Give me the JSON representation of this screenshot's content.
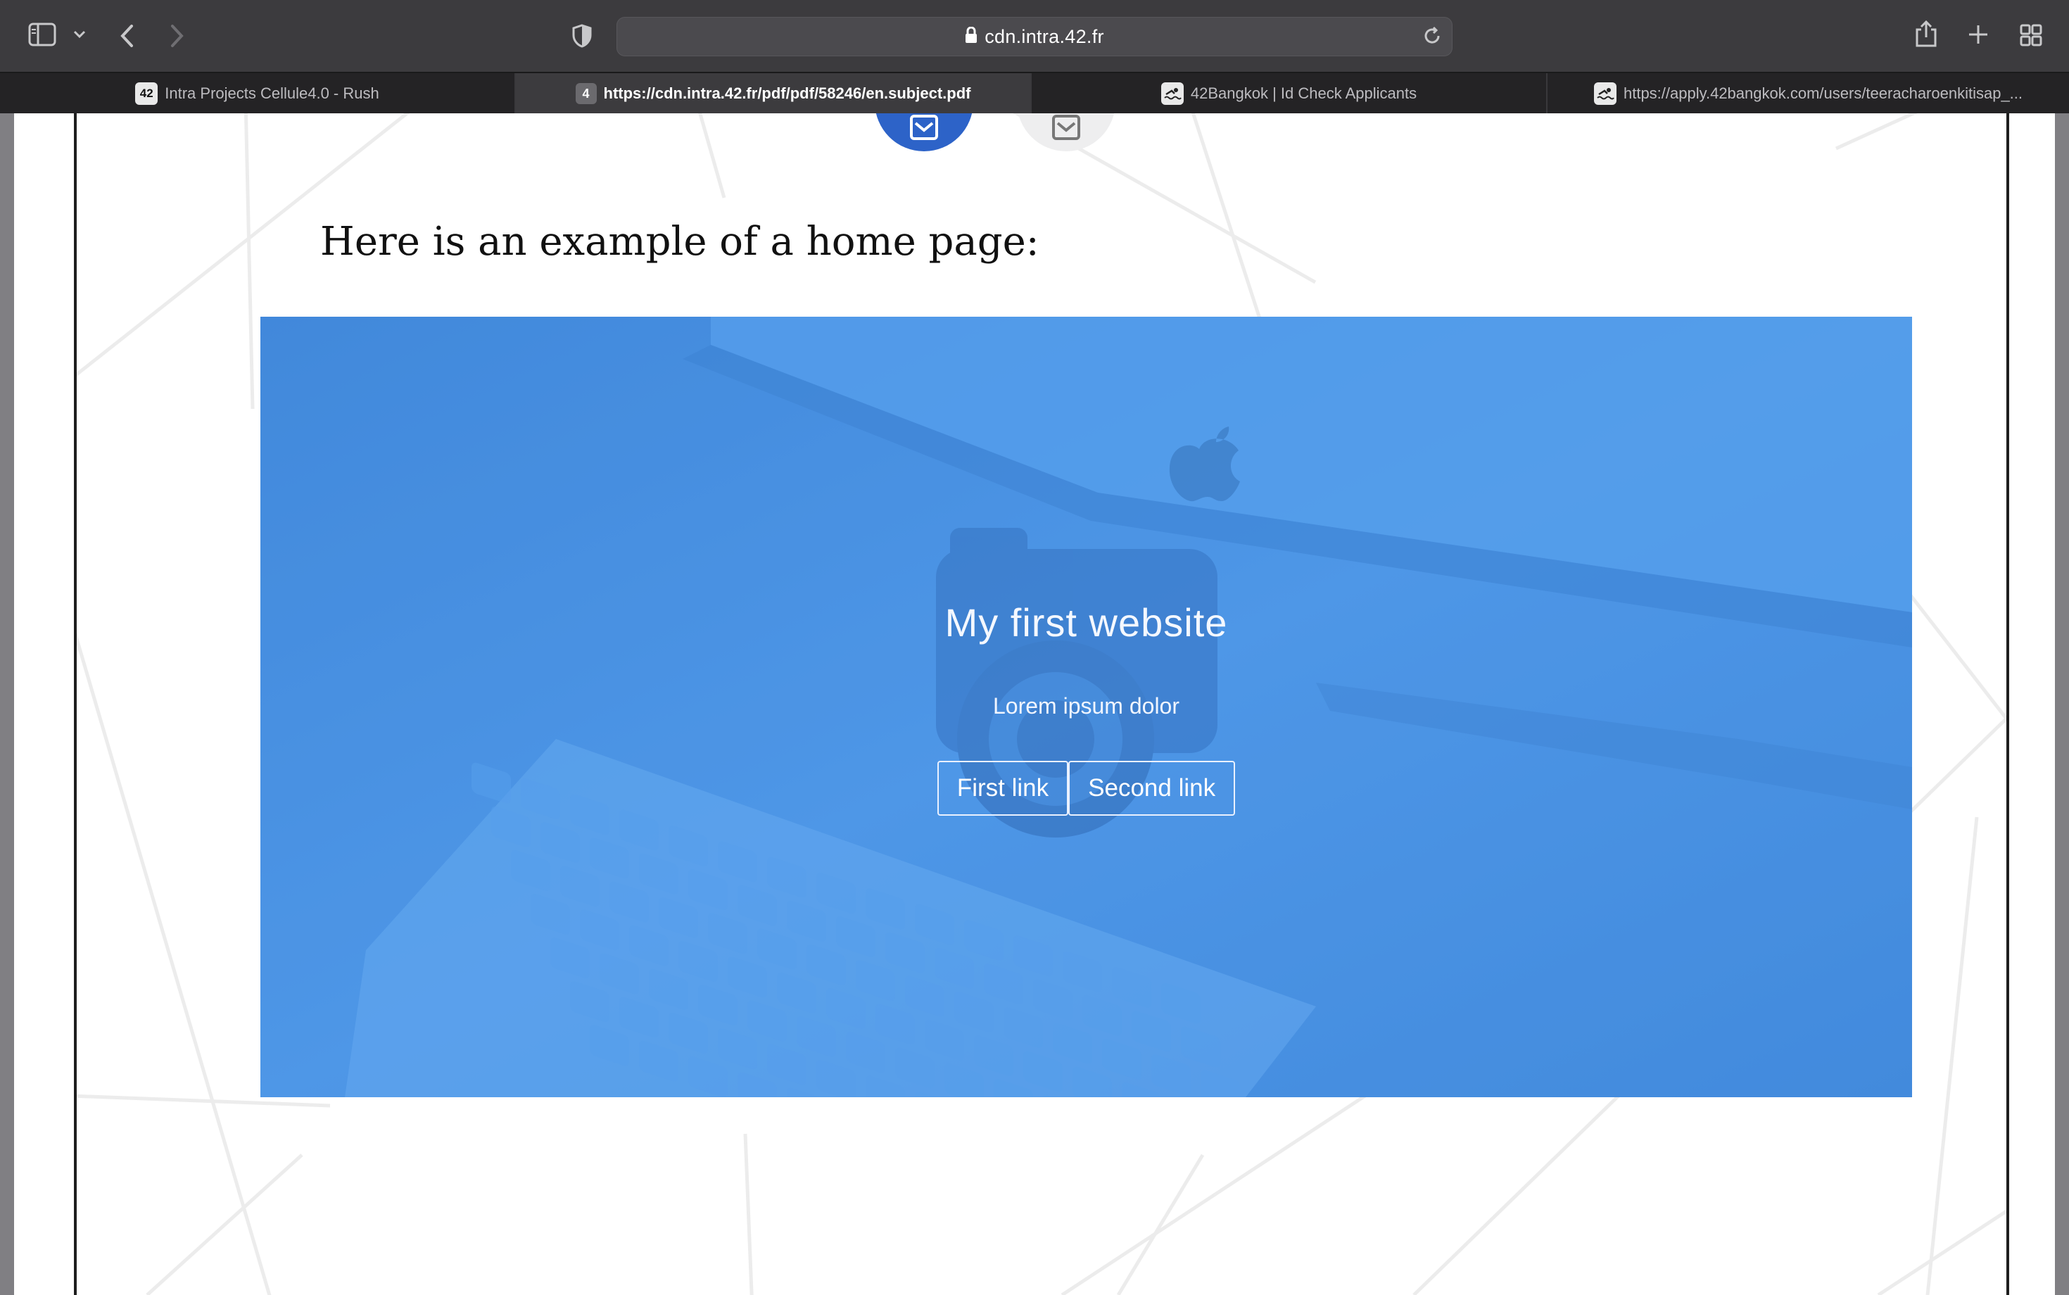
{
  "browser": {
    "address_url": "cdn.intra.42.fr",
    "tabs": [
      {
        "label": "Intra Projects Cellule4.0 - Rush",
        "favicon": "42"
      },
      {
        "label": "https://cdn.intra.42.fr/pdf/pdf/58246/en.subject.pdf",
        "favicon": "4"
      },
      {
        "label": "42Bangkok | Id Check Applicants",
        "favicon": "swim"
      },
      {
        "label": "https://apply.42bangkok.com/users/teeracharoenkitisap_...",
        "favicon": "swim"
      }
    ],
    "active_tab_index": 1
  },
  "document": {
    "intro_text": "Here is an example of a home page:",
    "example": {
      "title": "My first website",
      "subtitle": "Lorem ipsum dolor",
      "buttons": [
        "First link",
        "Second link"
      ]
    }
  },
  "colors": {
    "hero_blue": "#4a92e2",
    "circle_blue": "#2d63c8"
  }
}
